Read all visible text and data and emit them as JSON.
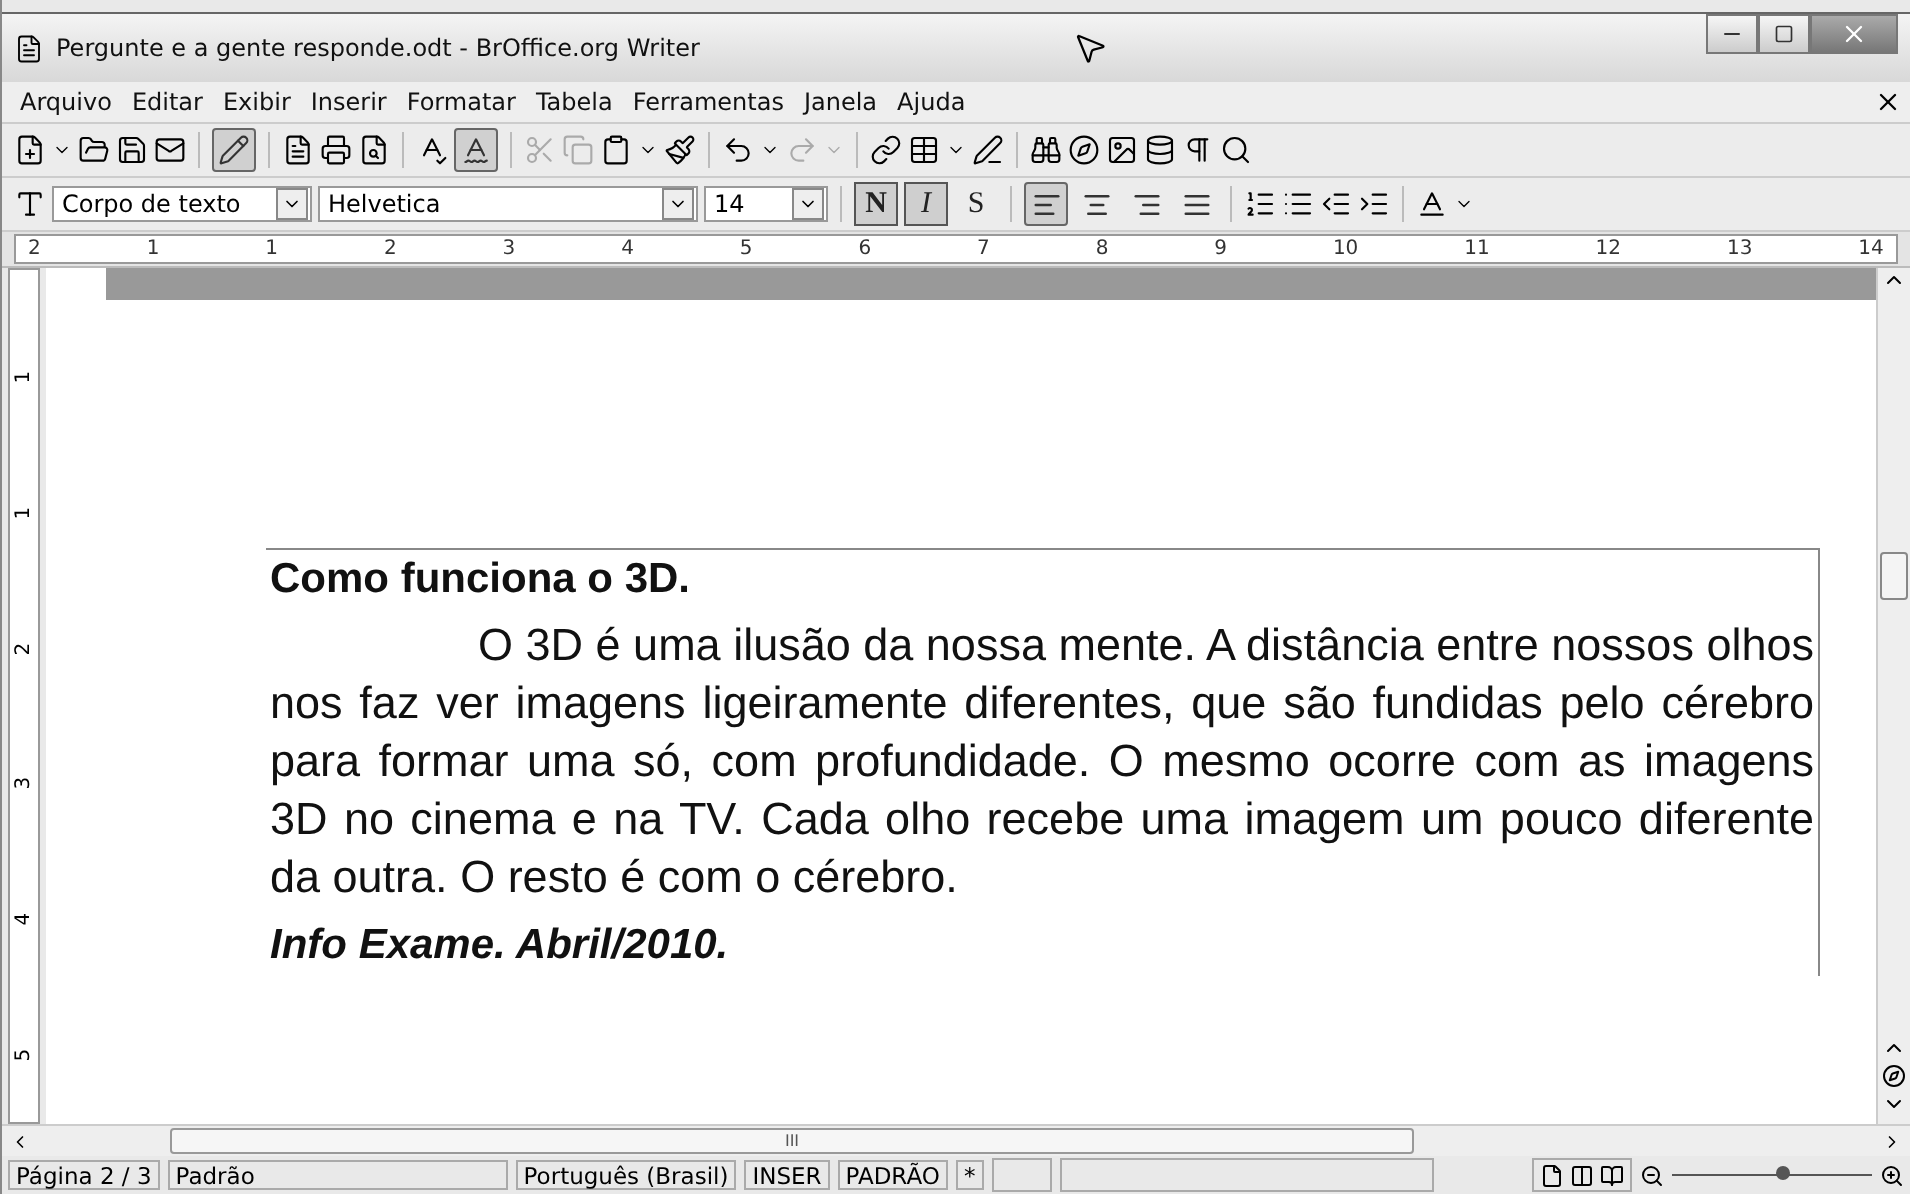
{
  "window": {
    "title": "Pergunte e a gente responde.odt - BrOffice.org Writer"
  },
  "menu": [
    {
      "label": "Arquivo"
    },
    {
      "label": "Editar"
    },
    {
      "label": "Exibir"
    },
    {
      "label": "Inserir"
    },
    {
      "label": "Formatar"
    },
    {
      "label": "Tabela"
    },
    {
      "label": "Ferramentas"
    },
    {
      "label": "Janela"
    },
    {
      "label": "Ajuda"
    }
  ],
  "standard_toolbar": {
    "edit_mode_on": true,
    "autospell_on": true
  },
  "formatting_toolbar": {
    "paragraph_style": "Corpo de texto",
    "font_name": "Helvetica",
    "font_size": "14",
    "style_buttons": [
      {
        "label": "N",
        "pressed": true,
        "kind": "bold"
      },
      {
        "label": "I",
        "pressed": true,
        "kind": "italic"
      },
      {
        "label": "S",
        "pressed": false,
        "kind": "shadow"
      }
    ],
    "align_buttons": [
      {
        "selected": true,
        "kind": "left"
      },
      {
        "selected": false,
        "kind": "center"
      },
      {
        "selected": false,
        "kind": "right"
      },
      {
        "selected": false,
        "kind": "justify"
      }
    ]
  },
  "ruler": {
    "labels": [
      "2",
      "1",
      "1",
      "2",
      "3",
      "4",
      "5",
      "6",
      "7",
      "8",
      "9",
      "10",
      "11",
      "12",
      "13",
      "14"
    ]
  },
  "vertical_ruler": {
    "labels": [
      "1",
      "1",
      "2",
      "3",
      "4",
      "5"
    ]
  },
  "document": {
    "heading": "Como funciona o 3D.",
    "paragraph": "O 3D é uma ilusão da nossa mente. A distância entre nossos olhos nos faz ver imagens ligeiramente diferentes, que são fundidas pelo cérebro para formar uma só, com profundidade. O mesmo ocorre com as imagens 3D no cinema e na TV. Cada olho recebe uma imagem um pouco diferente da outra. O resto é com o cérebro.",
    "source": "Info Exame. Abril/2010."
  },
  "horizontal_scrollbar": {
    "grip": "III"
  },
  "zoom_slider": {
    "level": 0.55
  },
  "status_bar": {
    "page": "Página 2 / 3",
    "page_style": "Padrão",
    "language": "Português (Brasil)",
    "insert_mode": "INSER",
    "selection_mode": "PADRÃO",
    "modified": "*"
  }
}
